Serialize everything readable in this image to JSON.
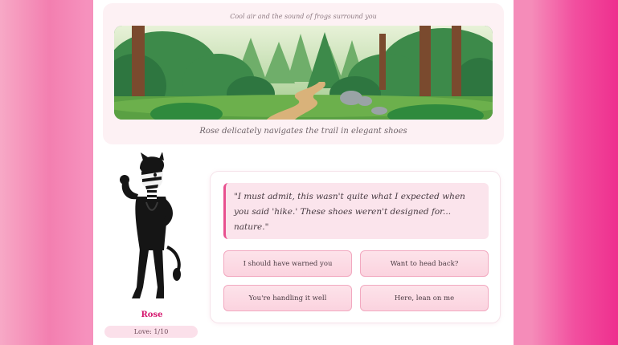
{
  "scene": {
    "ambient": "Cool air and the sound of frogs surround you",
    "narration": "Rose delicately navigates the trail in elegant shoes"
  },
  "character": {
    "name": "Rose",
    "love": "Love: 1/10"
  },
  "dialog": {
    "quote": "\"I must admit, this wasn't quite what I expected when you said 'hike.' These shoes weren't designed for... nature.\""
  },
  "choices": [
    {
      "label": "I should have warned you"
    },
    {
      "label": "Want to head back?"
    },
    {
      "label": "You're handling it well"
    },
    {
      "label": "Here, lean on me"
    }
  ],
  "colors": {
    "accent": "#d6196f",
    "choice_fill": "#fbd3df",
    "page_bg": "#f58cb9"
  }
}
